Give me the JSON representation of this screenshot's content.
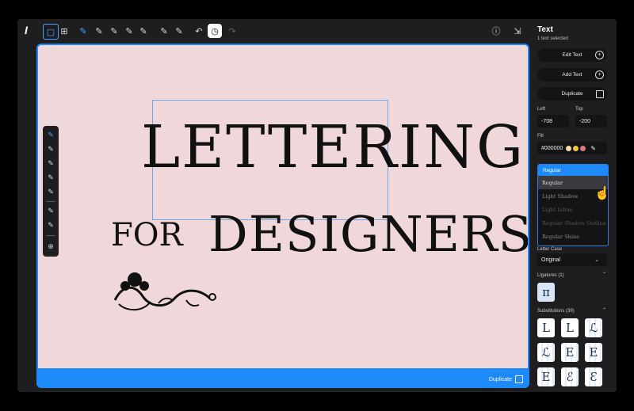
{
  "toolbar": {
    "logo": "I",
    "tools": [
      {
        "icon": "select-frame-icon",
        "glyph": "▢"
      },
      {
        "icon": "grid-icon",
        "glyph": "⊞"
      },
      {
        "icon": "pen-tool-icon",
        "glyph": "✎"
      },
      {
        "icon": "node-tool-icon",
        "glyph": "✎"
      },
      {
        "icon": "curve-tool-icon",
        "glyph": "✎"
      },
      {
        "icon": "line-tool-icon",
        "glyph": "✎"
      },
      {
        "icon": "anchor-tool-icon",
        "glyph": "✎"
      },
      {
        "icon": "brush-tool-icon",
        "glyph": "✎"
      },
      {
        "icon": "eraser-tool-icon",
        "glyph": "✎"
      }
    ],
    "undo_glyph": "↶",
    "history_glyph": "◷",
    "redo_glyph": "↷",
    "info_glyph": "ⓘ",
    "export_glyph": "⇲"
  },
  "canvas": {
    "background": "#f0d8da",
    "line1": "LETTERING",
    "line2a": "FOR",
    "line2b": "DESIGNERS",
    "duplicate_label": "Duplicate"
  },
  "palette": {
    "tools": [
      "✎",
      "✎",
      "✎",
      "✎",
      "✎",
      "✎",
      "✎",
      "⊕"
    ]
  },
  "panel": {
    "title": "Text",
    "subtitle": "1 text selected",
    "edit_text": "Edit Text",
    "add_text": "Add Text",
    "duplicate": "Duplicate",
    "left_label": "Left",
    "left_value": "-708",
    "top_label": "Top",
    "top_value": "-200",
    "fill_label": "Fill",
    "fill_value": "#000000",
    "fill_swatches": [
      "#f7d7a0",
      "#f4c542",
      "#e07a7a"
    ],
    "dropdown_selected": "Regular",
    "dropdown_options": [
      "Regular",
      "Light Shadow",
      "Light Inline",
      "Regular Shadow Outline",
      "Regular Shine"
    ],
    "letter_case_label": "Letter Case",
    "letter_case_value": "Original",
    "ligatures_label": "Ligatures (1)",
    "ligature_glyph": "π",
    "substitutions_label": "Substitutions (39)",
    "substitutions": [
      "L",
      "L",
      "ℒ",
      "ℒ",
      "E",
      "E",
      "E",
      "ℰ",
      "Ɛ"
    ]
  }
}
